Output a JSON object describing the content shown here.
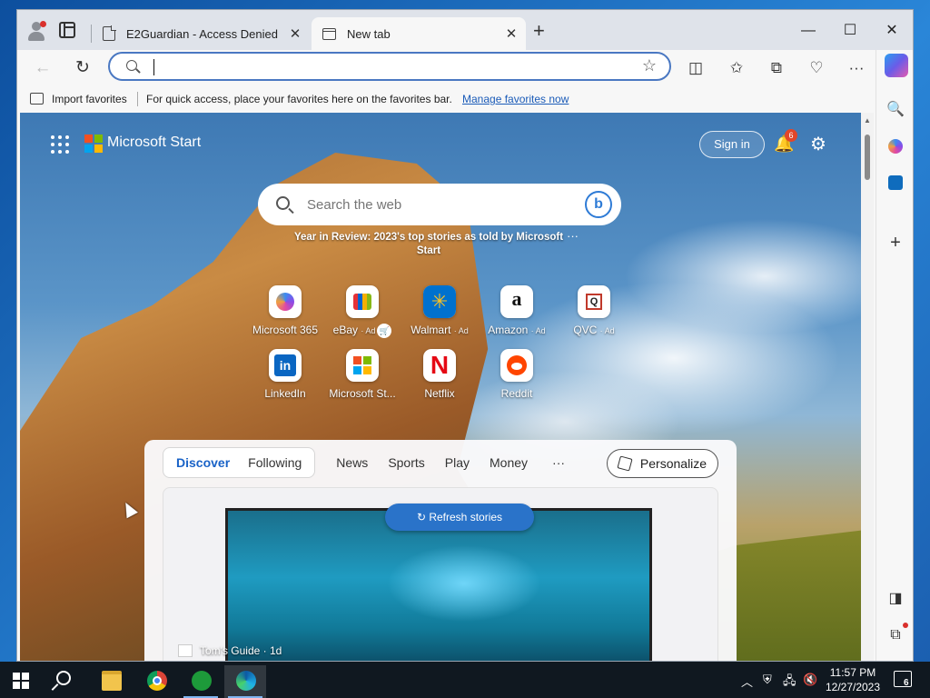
{
  "window": {
    "tabs": [
      {
        "label": "E2Guardian - Access Denied",
        "close": "✕"
      },
      {
        "label": "New tab",
        "close": "✕"
      }
    ],
    "new_tab": "+",
    "controls": {
      "minimize": "—",
      "maximize": "☐",
      "close": "✕"
    }
  },
  "toolbar": {
    "back": "←",
    "refresh": "↻",
    "address_value": "",
    "favorite_star": "☆",
    "split_screen": "◫",
    "favorites": "✩",
    "collections": "⧉",
    "performance": "♡",
    "more": "···"
  },
  "favbar": {
    "import": "Import favorites",
    "message": "For quick access, place your favorites here on the favorites bar.",
    "manage_link": "Manage favorites now"
  },
  "ntp": {
    "brand": "Microsoft Start",
    "sign_in": "Sign in",
    "notifications_count": "6",
    "bell": "🔔",
    "gear": "⚙",
    "search_placeholder": "Search the web",
    "bing": "b",
    "year_in_review": "Year in Review: 2023's top stories as told by Microsoft Start",
    "year_in_review_more": "···",
    "tiles": [
      {
        "label": "Microsoft 365",
        "ad": ""
      },
      {
        "label": "eBay",
        "ad": "· Ad"
      },
      {
        "label": "Walmart",
        "ad": "· Ad"
      },
      {
        "label": "Amazon",
        "ad": "· Ad"
      },
      {
        "label": "QVC",
        "ad": "· Ad"
      },
      {
        "label": "LinkedIn",
        "ad": ""
      },
      {
        "label": "Microsoft St...",
        "ad": ""
      },
      {
        "label": "Netflix",
        "ad": ""
      },
      {
        "label": "Reddit",
        "ad": ""
      }
    ],
    "tile_glyphs": {
      "walmart": "✳",
      "amazon": "a",
      "qvc": "Q",
      "linkedin": "in",
      "netflix": "N"
    },
    "feed": {
      "tabs": [
        "Discover",
        "Following",
        "News",
        "Sports",
        "Play",
        "Money"
      ],
      "more": "···",
      "personalize": "Personalize",
      "refresh": "↻ Refresh stories",
      "source": "Tom's Guide · 1d"
    }
  },
  "scrollbar": {
    "up_arrow": "▲"
  },
  "sidebar": {
    "search": "🔍",
    "add": "+",
    "split": "◨",
    "external": "⧉",
    "settings": "⚙"
  },
  "taskbar": {
    "clock_time": "11:57 PM",
    "clock_date": "12/27/2023",
    "notification_count": "6",
    "tray": {
      "chevron": "︿",
      "network": "🖧",
      "volume": "🔇"
    }
  },
  "colors": {
    "accent": "#1a63c7",
    "refresh_button": "#2a73c9",
    "notification_badge": "#e2462a"
  }
}
